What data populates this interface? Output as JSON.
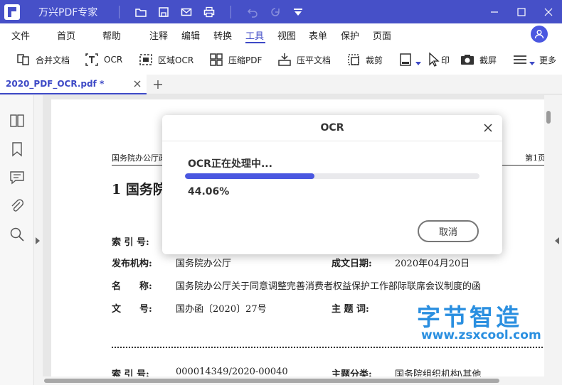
{
  "app": {
    "title": "万兴PDF专家",
    "accent": "#4650c8"
  },
  "menu": {
    "items": [
      "文件",
      "首页",
      "帮助",
      "注释",
      "编辑",
      "转换",
      "工具",
      "视图",
      "表单",
      "保护",
      "页面"
    ],
    "active": "工具"
  },
  "toolbar": {
    "tools": [
      {
        "label": "合并文档",
        "icon": "merge-icon"
      },
      {
        "label": "OCR",
        "icon": "ocr-icon"
      },
      {
        "label": "区域OCR",
        "icon": "area-ocr-icon"
      },
      {
        "label": "压缩PDF",
        "icon": "compress-icon"
      },
      {
        "label": "压平文档",
        "icon": "flatten-icon"
      },
      {
        "label": "裁剪",
        "icon": "crop-icon"
      },
      {
        "label": "印",
        "icon": "print-icon"
      },
      {
        "label": "截屏",
        "icon": "screenshot-icon"
      },
      {
        "label": "更多",
        "icon": "more-icon"
      }
    ]
  },
  "tab": {
    "label": "2020_PDF_OCR.pdf *"
  },
  "document": {
    "header_left": "国务院办公厅政",
    "header_right": "第1页",
    "title": "1 国务院",
    "fields": [
      {
        "label": "索 引 号:",
        "value": ""
      },
      {
        "label": "发布机构:",
        "value": "国务院办公厅"
      },
      {
        "label": "成文日期:",
        "value": "2020年04月20日"
      },
      {
        "label": "名　　称:",
        "value": "国务院办公厅关于同意调整完善消费者权益保护工作部际联席会议制度的函"
      },
      {
        "label": "文　　号:",
        "value": "国办函〔2020〕27号"
      },
      {
        "label": "主 题 词:",
        "value": ""
      },
      {
        "label": "索 引 号:",
        "value": "000014349/2020-00040"
      },
      {
        "label": "主题分类:",
        "value": "国务院组织机构\\其他"
      }
    ]
  },
  "watermark": {
    "cn": "字节智造",
    "url": "www.zsxcool.com"
  },
  "dialog": {
    "title": "OCR",
    "status": "OCR正在处理中...",
    "percent_text": "44.06%",
    "progress": 44.06,
    "cancel_label": "取消"
  }
}
